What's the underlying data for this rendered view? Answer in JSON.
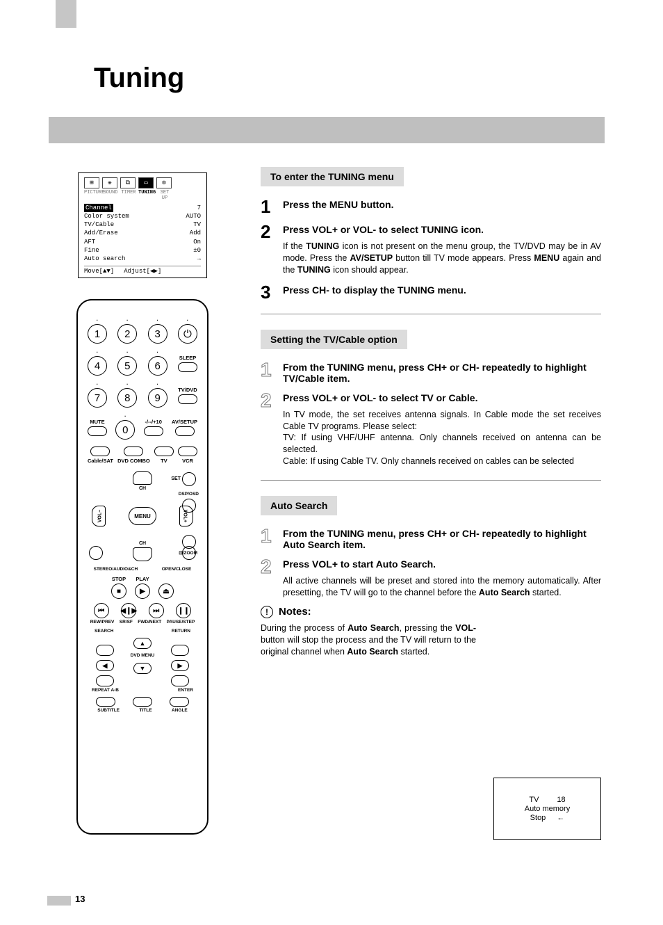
{
  "page": {
    "title": "Tuning",
    "number": "13"
  },
  "osd": {
    "labels": [
      "PICTURE",
      "SOUND",
      "TIMER",
      "TUNING",
      "SET UP"
    ],
    "active_label_index": 3,
    "rows": [
      {
        "k": "Channel",
        "v": "7",
        "hl": true
      },
      {
        "k": "Color system",
        "v": "AUTO"
      },
      {
        "k": "TV/Cable",
        "v": "TV"
      },
      {
        "k": "Add/Erase",
        "v": "Add"
      },
      {
        "k": "AFT",
        "v": "On"
      },
      {
        "k": "Fine",
        "v": "±0"
      },
      {
        "k": "Auto search",
        "v": "→"
      }
    ],
    "footer_move": "Move[▲▼]",
    "footer_adjust": "Adjust[◀▶]"
  },
  "remote": {
    "numbers": [
      "1",
      "2",
      "3",
      "4",
      "5",
      "6",
      "7",
      "8",
      "9",
      "0"
    ],
    "power_icon": "⏻",
    "sleep": "SLEEP",
    "tvdvd": "TV/DVD",
    "mute": "MUTE",
    "plus10": "-/--/+10",
    "avsetup": "AV/SETUP",
    "cablesat": "Cable/SAT",
    "dvdcombo": "DVD COMBO",
    "tv": "TV",
    "vcr": "VCR",
    "set": "SET",
    "ch": "CH",
    "vol_minus": "VOL",
    "vol_plus": "VOL",
    "menu": "MENU",
    "dsposd": "DSP/OSD",
    "zoom": "⊡/ZOOM",
    "stereo": "STEREO/AUDIO&CH",
    "openclose": "OPEN/CLOSE",
    "stop": "STOP",
    "play": "PLAY",
    "eject": "⏏",
    "stop_sym": "■",
    "play_sym": "▶",
    "rewprev": "REW/PREV",
    "srsf": "SR/SF",
    "fwdnext": "FWD/NEXT",
    "pausestep": "PAUSE/STEP",
    "skipb": "⏮",
    "stepb": "◀❙▶",
    "skipf": "⏭",
    "pause": "❙❙",
    "search": "SEARCH",
    "return": "RETURN",
    "dvdmenu": "DVD MENU",
    "repeat": "REPEAT A-B",
    "enter": "ENTER",
    "subtitle": "SUBTITLE",
    "title_b": "TITLE",
    "angle": "ANGLE",
    "up": "▲",
    "down": "▼",
    "left": "◀",
    "right": "▶"
  },
  "sections": {
    "enter": {
      "header": "To enter the TUNING menu",
      "s1_num": "1",
      "s1": "Press the MENU button.",
      "s2_num": "2",
      "s2": "Press VOL+ or VOL- to select TUNING icon.",
      "s2_body_a": "If the ",
      "s2_body_b": "TUNING",
      "s2_body_c": " icon is not present on the menu group, the TV/DVD may be in AV mode. Press the ",
      "s2_body_d": "AV/SETUP",
      "s2_body_e": " button till TV mode appears. Press ",
      "s2_body_f": "MENU",
      "s2_body_g": " again and the ",
      "s2_body_h": "TUNING",
      "s2_body_i": " icon should appear.",
      "s3_num": "3",
      "s3": "Press CH- to display the TUNING menu."
    },
    "tvcable": {
      "header": "Setting the TV/Cable option",
      "s1": "From the TUNING menu, press CH+ or CH- repeatedly to highlight TV/Cable item.",
      "s2": "Press VOL+ or VOL- to select TV or Cable.",
      "body_a": "In TV mode, the set receives antenna signals. In Cable mode the set receives Cable TV programs. Please select:",
      "body_b": "TV: If using VHF/UHF antenna. Only channels received on antenna can be selected.",
      "body_c": "Cable:  If using Cable TV. Only channels received on cables can be selected"
    },
    "auto": {
      "header": "Auto Search",
      "s1": "From the TUNING menu, press CH+ or CH- repeatedly to highlight Auto Search item.",
      "s2": "Press VOL+ to start Auto Search.",
      "body_a": "All active channels will be preset and stored into the memory automatically. After presetting, the TV will go to the channel before the ",
      "body_b": "Auto Search",
      "body_c": " started."
    },
    "notes": {
      "header": "Notes:",
      "body_a": "During the process of ",
      "body_b": "Auto Search",
      "body_c": ", pressing the ",
      "body_d": "VOL-",
      "body_e": " button will stop the process and the TV will return to the original channel when ",
      "body_f": "Auto Search",
      "body_g": " started."
    }
  },
  "osd_small": {
    "r1a": "TV",
    "r1b": "18",
    "r2": "Auto memory",
    "r3a": "Stop",
    "r3b": "←"
  }
}
